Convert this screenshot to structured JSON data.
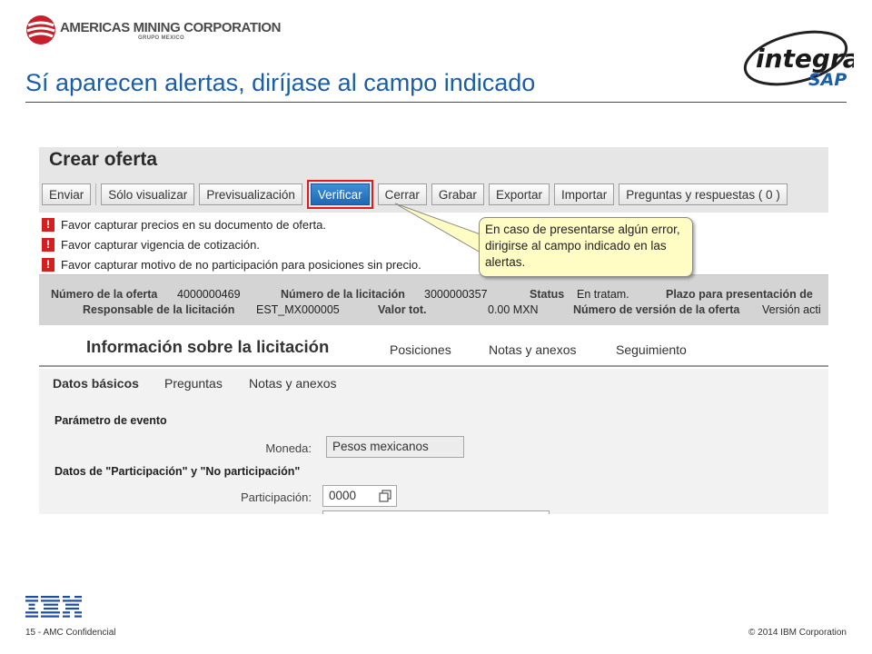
{
  "header": {
    "company_name": "AMERICAS MINING CORPORATION",
    "company_sub": "GRUPO MEXICO",
    "slide_title": "Sí aparecen alertas, diríjase al campo indicado",
    "integra_logo_text": "integra SAP"
  },
  "app": {
    "page_heading": "Crear oferta",
    "toolbar": {
      "enviar": "Enviar",
      "solo_visualizar": "Sólo visualizar",
      "previsualizacion": "Previsualización",
      "verificar": "Verificar",
      "cerrar": "Cerrar",
      "grabar": "Grabar",
      "exportar": "Exportar",
      "importar": "Importar",
      "preguntas": "Preguntas y respuestas ( 0 )"
    },
    "messages": [
      "Favor capturar precios en su documento de oferta.",
      "Favor capturar vigencia de cotización.",
      "Favor capturar motivo de no participación para posiciones sin precio."
    ],
    "callout": "En caso de presentarse algún error, dirigirse al campo indicado en las alertas.",
    "info": {
      "numero_oferta_label": "Número de la oferta",
      "numero_oferta": "4000000469",
      "numero_licitacion_label": "Número de la licitación",
      "numero_licitacion": "3000000357",
      "status_label": "Status",
      "status": "En tratam.",
      "plazo_label": "Plazo para presentación de",
      "responsable_label": "Responsable de la licitación",
      "responsable": "EST_MX000005",
      "valor_label": "Valor tot.",
      "valor": "0.00 MXN",
      "version_label": "Número de versión de la oferta",
      "version": "Versión acti"
    },
    "tabs": {
      "main": "Información sobre la licitación",
      "posiciones": "Posiciones",
      "notas": "Notas y anexos",
      "seguimiento": "Seguimiento"
    },
    "subtabs": {
      "datos_basicos": "Datos básicos",
      "preguntas": "Preguntas",
      "notas": "Notas y anexos"
    },
    "form": {
      "parametro_evento": "Parámetro de evento",
      "moneda_label": "Moneda:",
      "moneda_value": "Pesos mexicanos",
      "participacion_section": "Datos de \"Participación\" y \"No participación\"",
      "participacion_label": "Participación:",
      "participacion_value": "0000"
    }
  },
  "footer": {
    "ibm": "IBM",
    "left": "15 - AMC Confidencial",
    "right": "© 2014 IBM Corporation"
  },
  "colors": {
    "title_blue": "#1a5ea8",
    "verify_blue": "#2a78c6",
    "highlight_red": "#e11b1b",
    "error_red": "#d51f1f",
    "callout_yellow": "#fffcc4"
  }
}
